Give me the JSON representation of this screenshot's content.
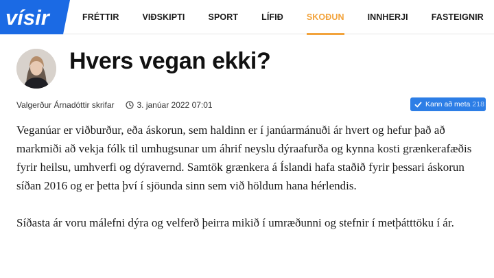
{
  "brand": {
    "logo_text": "vísir",
    "logo_color": "#1b6ae4"
  },
  "nav": {
    "items": [
      {
        "label": "FRÉTTIR",
        "active": false
      },
      {
        "label": "VIÐSKIPTI",
        "active": false
      },
      {
        "label": "SPORT",
        "active": false
      },
      {
        "label": "LÍFIÐ",
        "active": false
      },
      {
        "label": "SKOÐUN",
        "active": true
      },
      {
        "label": "INNHERJI",
        "active": false
      },
      {
        "label": "FASTEIGNIR",
        "active": false
      }
    ],
    "active_color": "#f2a33c"
  },
  "article": {
    "title": "Hvers vegan ekki?",
    "author_line": "Valgerður Árnadóttir skrifar",
    "date": "3. janúar 2022 07:01",
    "rate_label": "Kann að meta",
    "rate_count": "218",
    "paragraphs": [
      "Veganúar er viðburður, eða áskorun, sem haldinn er í janúarmánuði ár hvert og hefur það að markmiði að vekja fólk til umhugsunar um áhrif neyslu dýraafurða og kynna kosti grænkerafæðis fyrir heilsu, umhverfi og dýravernd. Samtök grænkera á Íslandi hafa staðið fyrir þessari áskorun síðan 2016 og er þetta því í sjöunda sinn sem við höldum hana hérlendis.",
      "Síðasta ár voru málefni dýra og velferð þeirra mikið í umræðunni og stefnir í metþátttöku í ár."
    ]
  }
}
